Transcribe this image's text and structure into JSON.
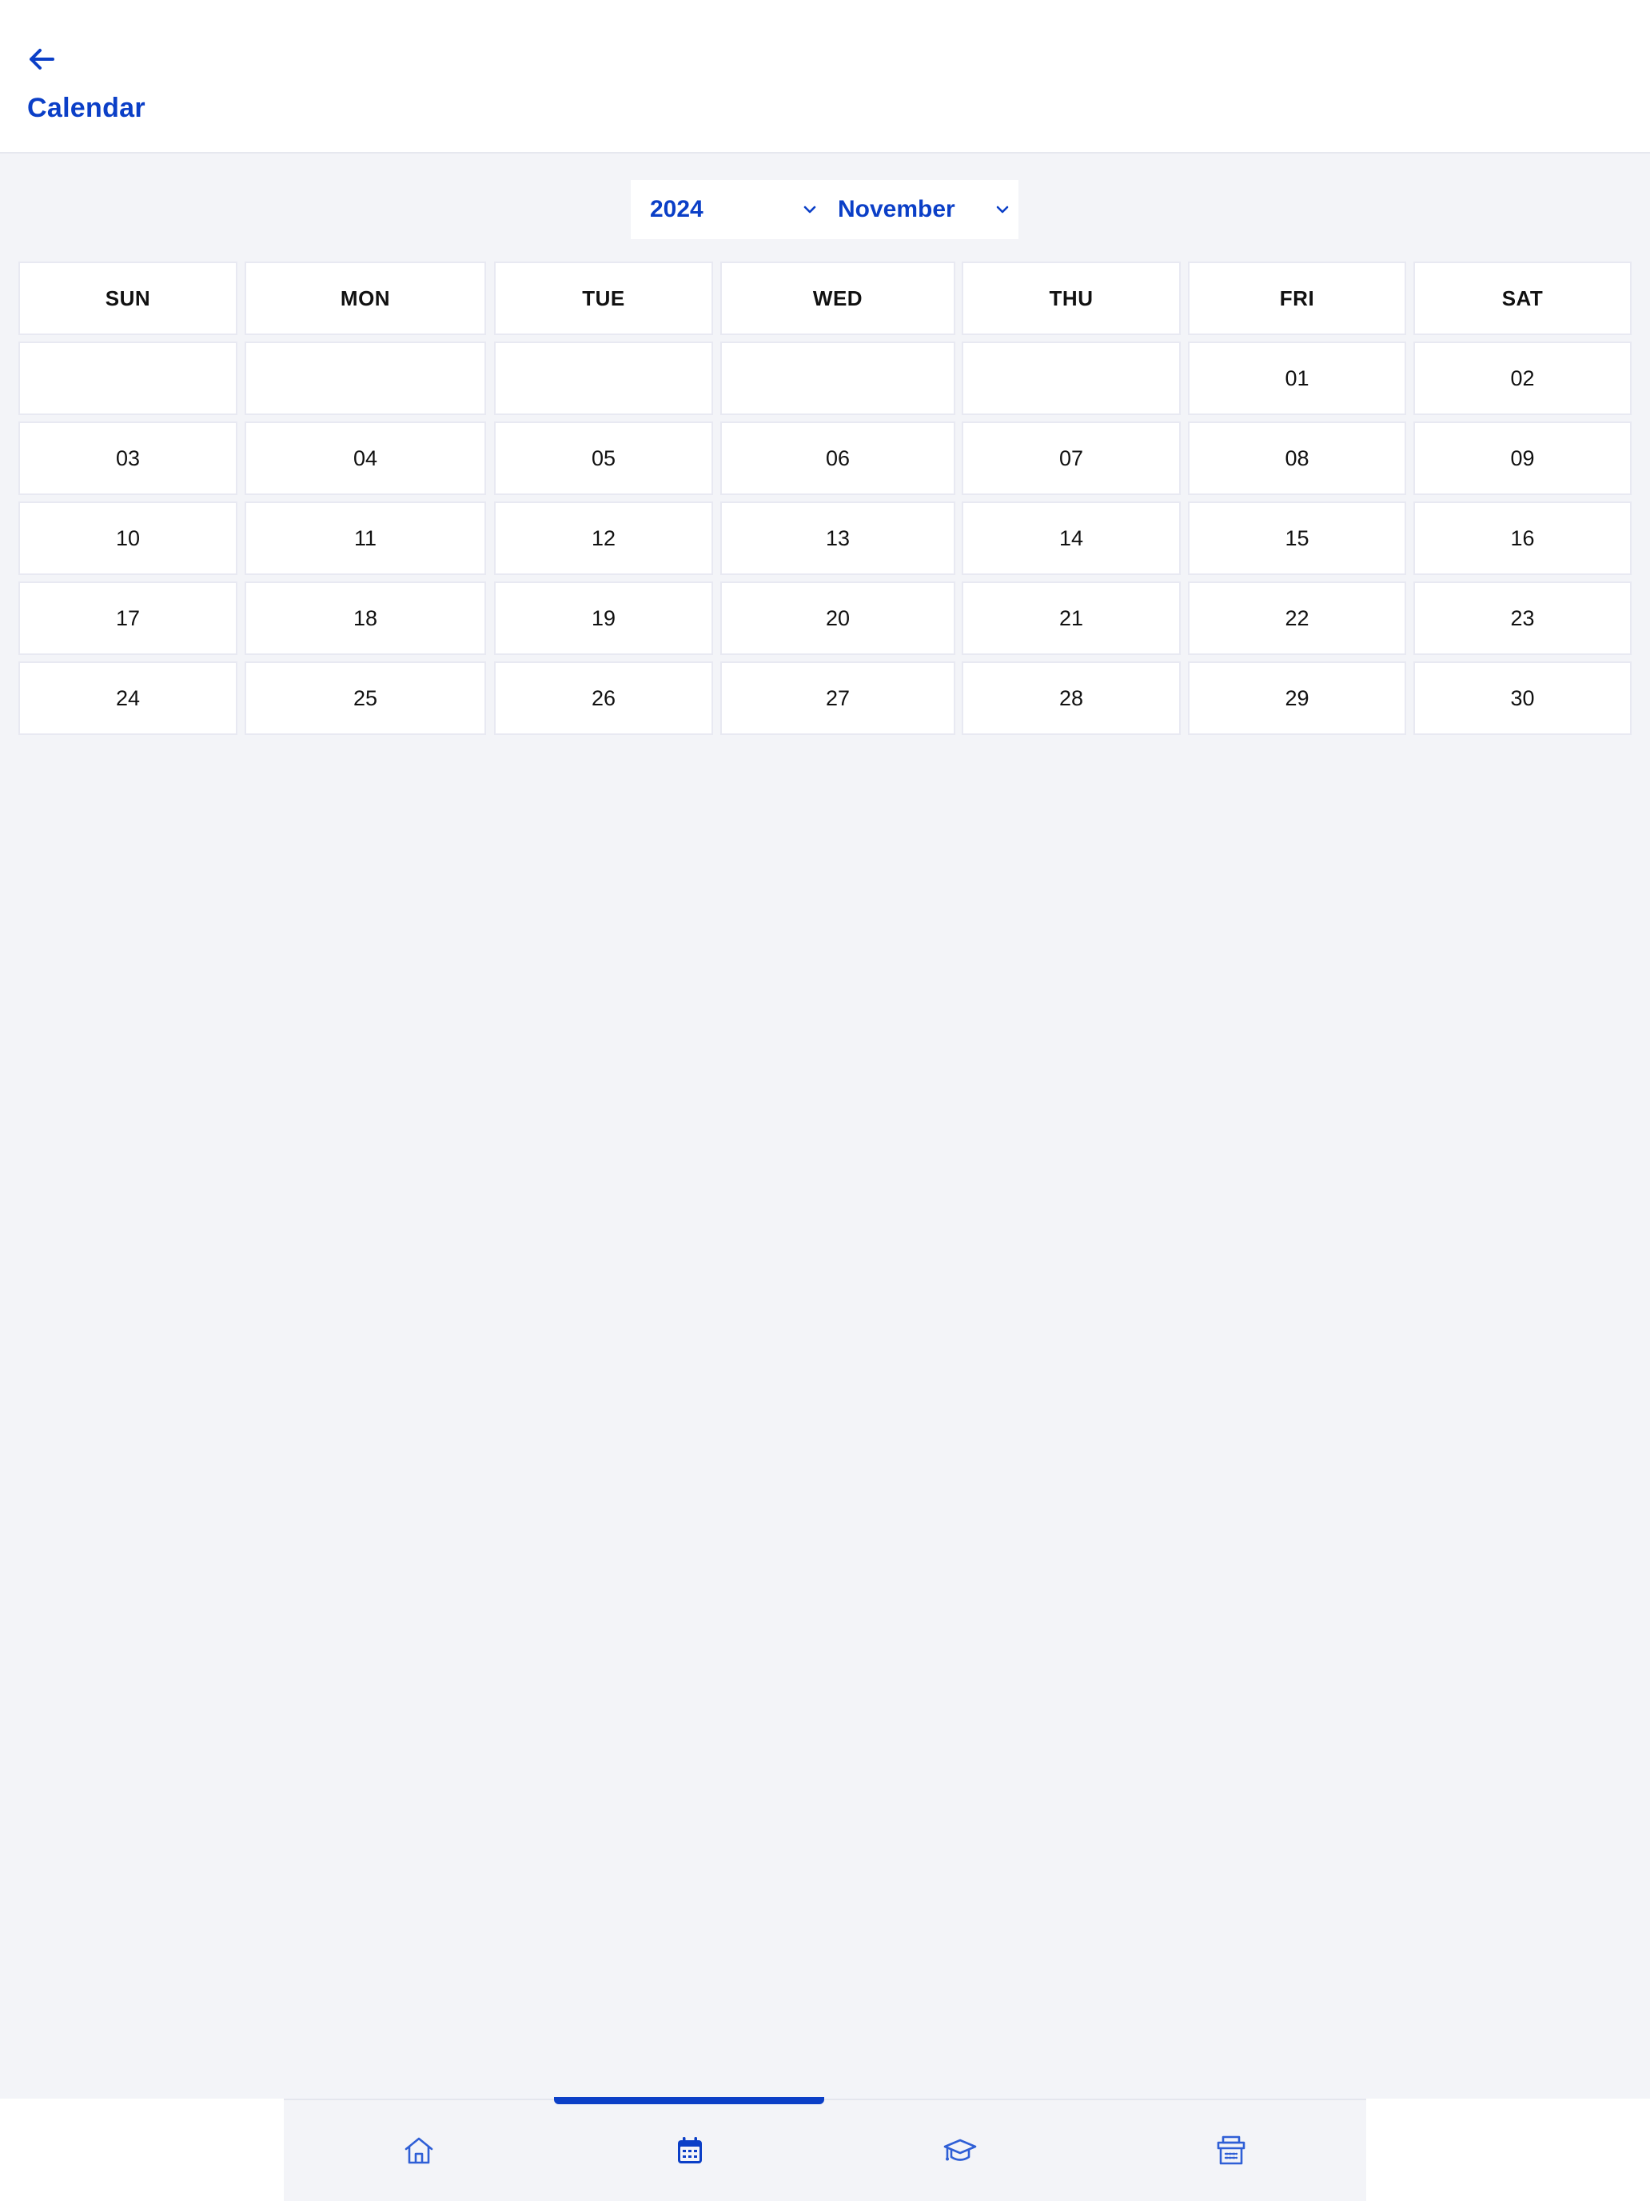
{
  "header": {
    "back_icon": "arrow-left-icon",
    "title": "Calendar"
  },
  "selectors": {
    "year": "2024",
    "month": "November",
    "chevron_icon": "chevron-down-icon"
  },
  "calendar": {
    "weekdays": [
      "SUN",
      "MON",
      "TUE",
      "WED",
      "THU",
      "FRI",
      "SAT"
    ],
    "weeks": [
      [
        "",
        "",
        "",
        "",
        "",
        "01",
        "02"
      ],
      [
        "03",
        "04",
        "05",
        "06",
        "07",
        "08",
        "09"
      ],
      [
        "10",
        "11",
        "12",
        "13",
        "14",
        "15",
        "16"
      ],
      [
        "17",
        "18",
        "19",
        "20",
        "21",
        "22",
        "23"
      ],
      [
        "24",
        "25",
        "26",
        "27",
        "28",
        "29",
        "30"
      ]
    ]
  },
  "bottom_nav": {
    "items": [
      {
        "icon": "home-icon",
        "active": false
      },
      {
        "icon": "calendar-icon",
        "active": true
      },
      {
        "icon": "graduation-cap-icon",
        "active": false
      },
      {
        "icon": "store-icon",
        "active": false
      }
    ]
  },
  "colors": {
    "accent": "#0b3fc7",
    "background": "#f3f4f8",
    "surface": "#ffffff"
  }
}
